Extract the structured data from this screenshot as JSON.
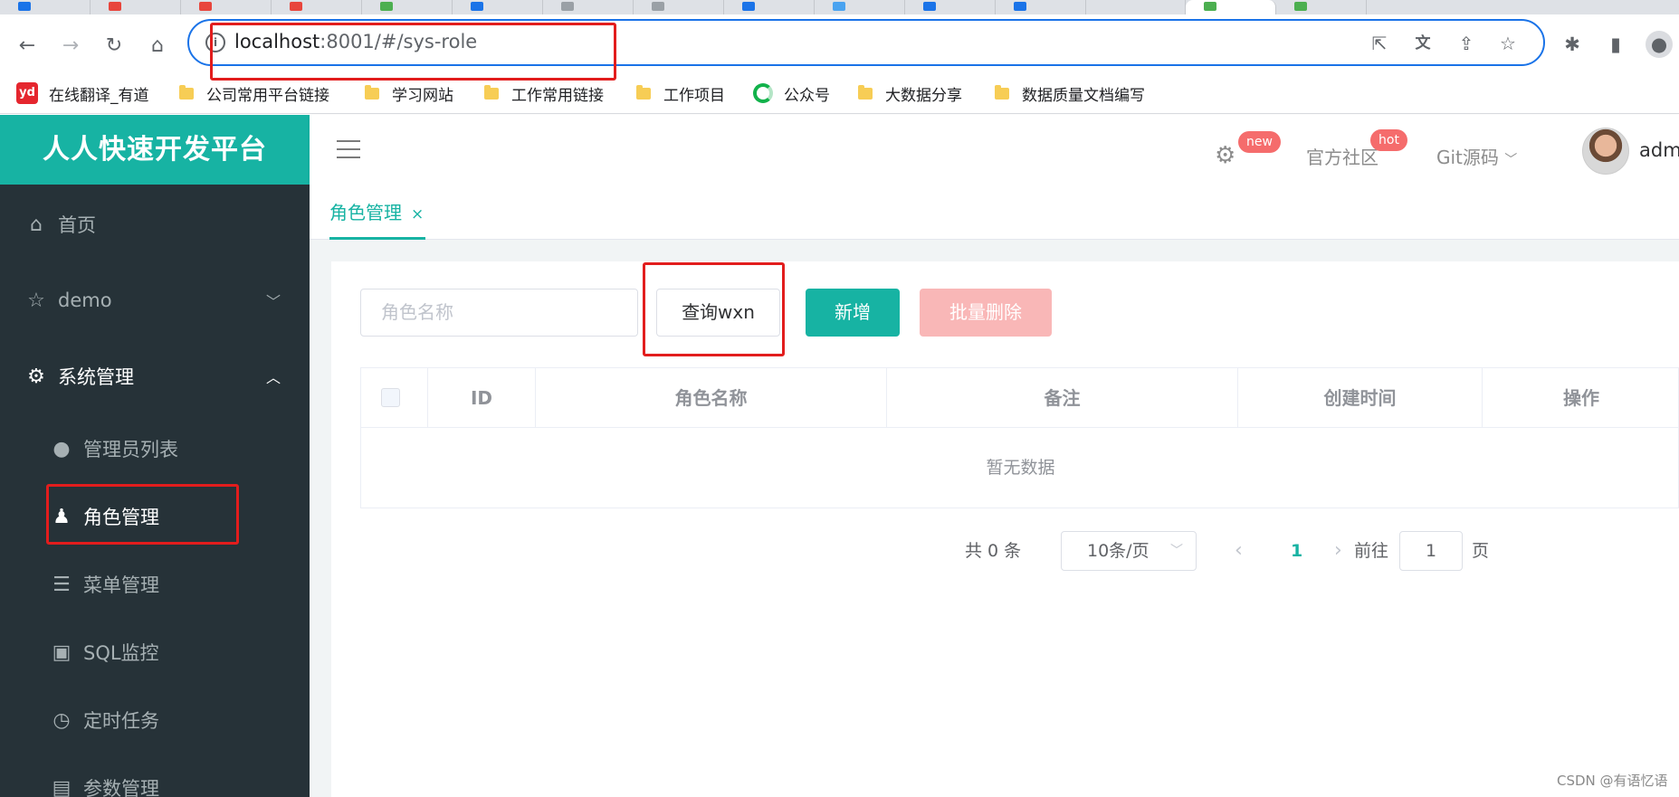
{
  "browser": {
    "url_host": "localhost",
    "url_path": ":8001/#/sys-role",
    "tab_favicon_colors": [
      "#1a73e8",
      "#e8453c",
      "#e8453c",
      "#e8453c",
      "#4caf50",
      "#1a73e8",
      "#9aa0a6",
      "#9aa0a6",
      "#1a73e8",
      "#4aa3f0",
      "#1a73e8",
      "#1a73e8",
      "#4caf50",
      "#4caf50"
    ]
  },
  "bookmarks": [
    {
      "label": "在线翻译_有道",
      "icon": "youdao-icon"
    },
    {
      "label": "公司常用平台链接",
      "icon": "folder-icon"
    },
    {
      "label": "学习网站",
      "icon": "folder-icon"
    },
    {
      "label": "工作常用链接",
      "icon": "folder-icon"
    },
    {
      "label": "工作项目",
      "icon": "folder-icon"
    },
    {
      "label": "公众号",
      "icon": "wechat-circle-icon"
    },
    {
      "label": "大数据分享",
      "icon": "folder-icon"
    },
    {
      "label": "数据质量文档编写",
      "icon": "folder-icon"
    }
  ],
  "app": {
    "brand": "人人快速开发平台",
    "header": {
      "new_badge": "new",
      "community": "官方社区",
      "hot_badge": "hot",
      "git": "Git源码",
      "username": "admin"
    },
    "menu": {
      "home": "首页",
      "demo": "demo",
      "system": "系统管理",
      "admin_list": "管理员列表",
      "role_mgmt": "角色管理",
      "menu_mgmt": "菜单管理",
      "sql_monitor": "SQL监控",
      "scheduled_tasks": "定时任务",
      "params_mgmt": "参数管理"
    },
    "tab": {
      "label": "角色管理",
      "close": "×"
    },
    "toolbar": {
      "search_placeholder": "角色名称",
      "query_label": "查询wxn",
      "add_label": "新增",
      "batch_delete_label": "批量删除"
    },
    "table": {
      "columns": [
        "ID",
        "角色名称",
        "备注",
        "创建时间",
        "操作"
      ],
      "empty_text": "暂无数据"
    },
    "pagination": {
      "total": "共 0 条",
      "page_size": "10条/页",
      "current_page": "1",
      "goto_label": "前往",
      "goto_value": "1",
      "page_suffix": "页"
    },
    "colors": {
      "accent": "#17b3a3",
      "sidebar": "#263238",
      "danger_light": "#f9b7b7",
      "annotation_red": "#e21d1d"
    }
  },
  "watermark": "CSDN @有语忆语"
}
